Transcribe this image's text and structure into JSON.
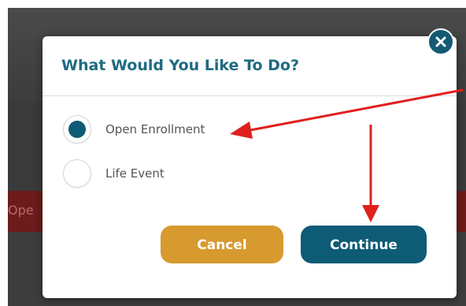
{
  "dialog": {
    "title": "What Would You Like To Do?",
    "options": [
      {
        "label": "Open Enrollment",
        "selected": true
      },
      {
        "label": "Life Event",
        "selected": false
      }
    ],
    "buttons": {
      "cancel_label": "Cancel",
      "continue_label": "Continue"
    },
    "close_icon": "close-icon"
  },
  "background": {
    "band_text": "Ope"
  },
  "annotations": {
    "arrow_color": "#e0201e",
    "arrows": [
      "arrow-to-open-enrollment",
      "arrow-to-continue-button"
    ]
  },
  "colors": {
    "title": "#1f6a82",
    "primary": "#0e5b75",
    "cancel": "#d69a2e",
    "band": "#6d1b1b"
  }
}
